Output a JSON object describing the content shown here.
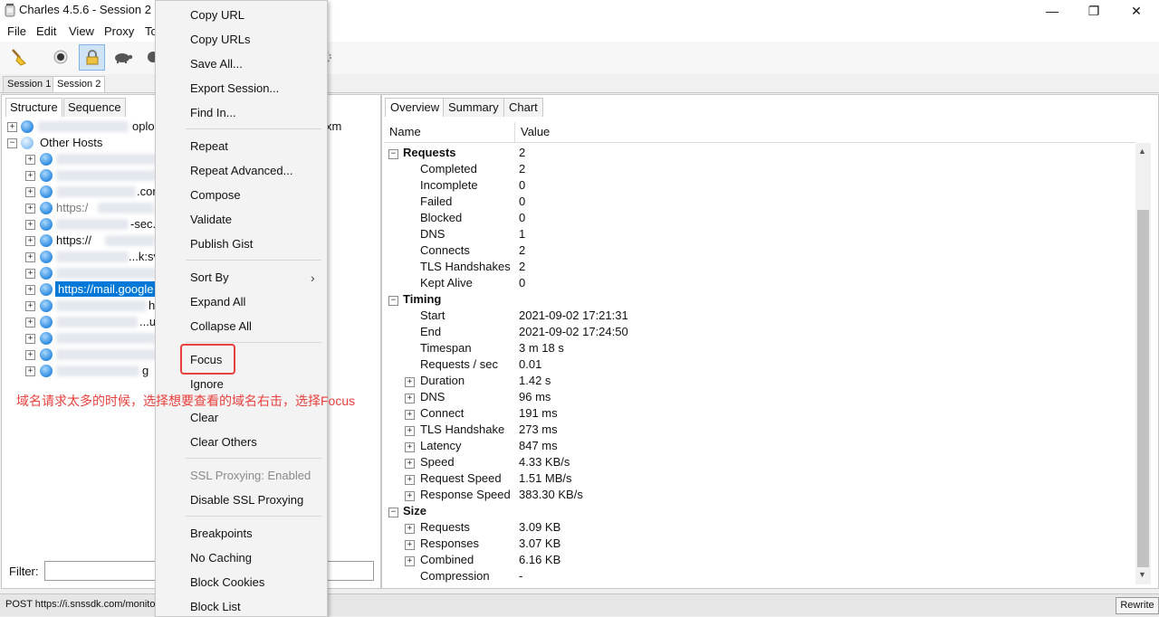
{
  "window": {
    "title": "Charles 4.5.6 - Session 2"
  },
  "menubar": [
    "File",
    "Edit",
    "View",
    "Proxy",
    "To"
  ],
  "session_tabs": [
    "Session 1",
    "Session 2"
  ],
  "left_panel": {
    "tabs": [
      "Structure",
      "Sequence"
    ],
    "tree": [
      {
        "text": "https://...oplog",
        "partial": "oplog",
        "tail": "xm"
      },
      {
        "text": "Other Hosts"
      },
      {
        "text": ""
      },
      {
        "text": ""
      },
      {
        "text": ".cor"
      },
      {
        "text": "https:/"
      },
      {
        "text": "-sec.h"
      },
      {
        "text": "https://"
      },
      {
        "text": "...k:svnc"
      },
      {
        "text": ""
      },
      {
        "text": "https://mail.google"
      },
      {
        "text": "h"
      },
      {
        "text": "...ut"
      },
      {
        "text": ""
      },
      {
        "text": ""
      },
      {
        "text": "g"
      }
    ],
    "filter_label": "Filter:"
  },
  "right_panel": {
    "tabs": [
      "Overview",
      "Summary",
      "Chart"
    ],
    "columns": [
      "Name",
      "Value"
    ],
    "sections": [
      {
        "title": "Requests",
        "value": "2",
        "rows": [
          {
            "name": "Completed",
            "value": "2"
          },
          {
            "name": "Incomplete",
            "value": "0"
          },
          {
            "name": "Failed",
            "value": "0"
          },
          {
            "name": "Blocked",
            "value": "0"
          },
          {
            "name": "DNS",
            "value": "1"
          },
          {
            "name": "Connects",
            "value": "2"
          },
          {
            "name": "TLS Handshakes",
            "value": "2"
          },
          {
            "name": "Kept Alive",
            "value": "0"
          }
        ]
      },
      {
        "title": "Timing",
        "value": "",
        "rows": [
          {
            "name": "Start",
            "value": "2021-09-02 17:21:31"
          },
          {
            "name": "End",
            "value": "2021-09-02 17:24:50"
          },
          {
            "name": "Timespan",
            "value": "3 m 18 s"
          },
          {
            "name": "Requests / sec",
            "value": "0.01"
          },
          {
            "name": "Duration",
            "value": "1.42 s",
            "expandable": true
          },
          {
            "name": "DNS",
            "value": "96 ms",
            "expandable": true
          },
          {
            "name": "Connect",
            "value": "191 ms",
            "expandable": true
          },
          {
            "name": "TLS Handshake",
            "value": "273 ms",
            "expandable": true
          },
          {
            "name": "Latency",
            "value": "847 ms",
            "expandable": true
          },
          {
            "name": "Speed",
            "value": "4.33 KB/s",
            "expandable": true
          },
          {
            "name": "Request Speed",
            "value": "1.51 MB/s",
            "expandable": true
          },
          {
            "name": "Response Speed",
            "value": "383.30 KB/s",
            "expandable": true
          }
        ]
      },
      {
        "title": "Size",
        "value": "",
        "rows": [
          {
            "name": "Requests",
            "value": "3.09 KB",
            "expandable": true
          },
          {
            "name": "Responses",
            "value": "3.07 KB",
            "expandable": true
          },
          {
            "name": "Combined",
            "value": "6.16 KB",
            "expandable": true
          },
          {
            "name": "Compression",
            "value": "-"
          }
        ]
      }
    ]
  },
  "context_menu": {
    "items": [
      "Copy URL",
      "Copy URLs",
      "Save All...",
      "Export Session...",
      "Find In...",
      "Repeat",
      "Repeat Advanced...",
      "Compose",
      "Validate",
      "Publish Gist",
      "Sort By",
      "Expand All",
      "Collapse All",
      "Focus",
      "Ignore",
      "Clear",
      "Clear Others",
      "SSL Proxying: Enabled",
      "Disable SSL Proxying",
      "Breakpoints",
      "No Caching",
      "Block Cookies",
      "Block List"
    ],
    "sort_by_arrow": "›"
  },
  "annotation": "域名请求太多的时候，选择想要查看的域名右击，选择Focus",
  "status": {
    "text": "POST https://i.snssdk.com/monito",
    "rewrite": "Rewrite"
  },
  "colors": {
    "accent_red": "#e8403d",
    "selection_blue": "#0078d7"
  },
  "icons": {
    "toolbar": [
      "broom-icon",
      "record-icon",
      "ssl-lock-icon",
      "turtle-icon",
      "stop-icon",
      "settings-gear-icon"
    ],
    "window": [
      "minimize-icon",
      "restore-icon",
      "close-icon"
    ]
  }
}
